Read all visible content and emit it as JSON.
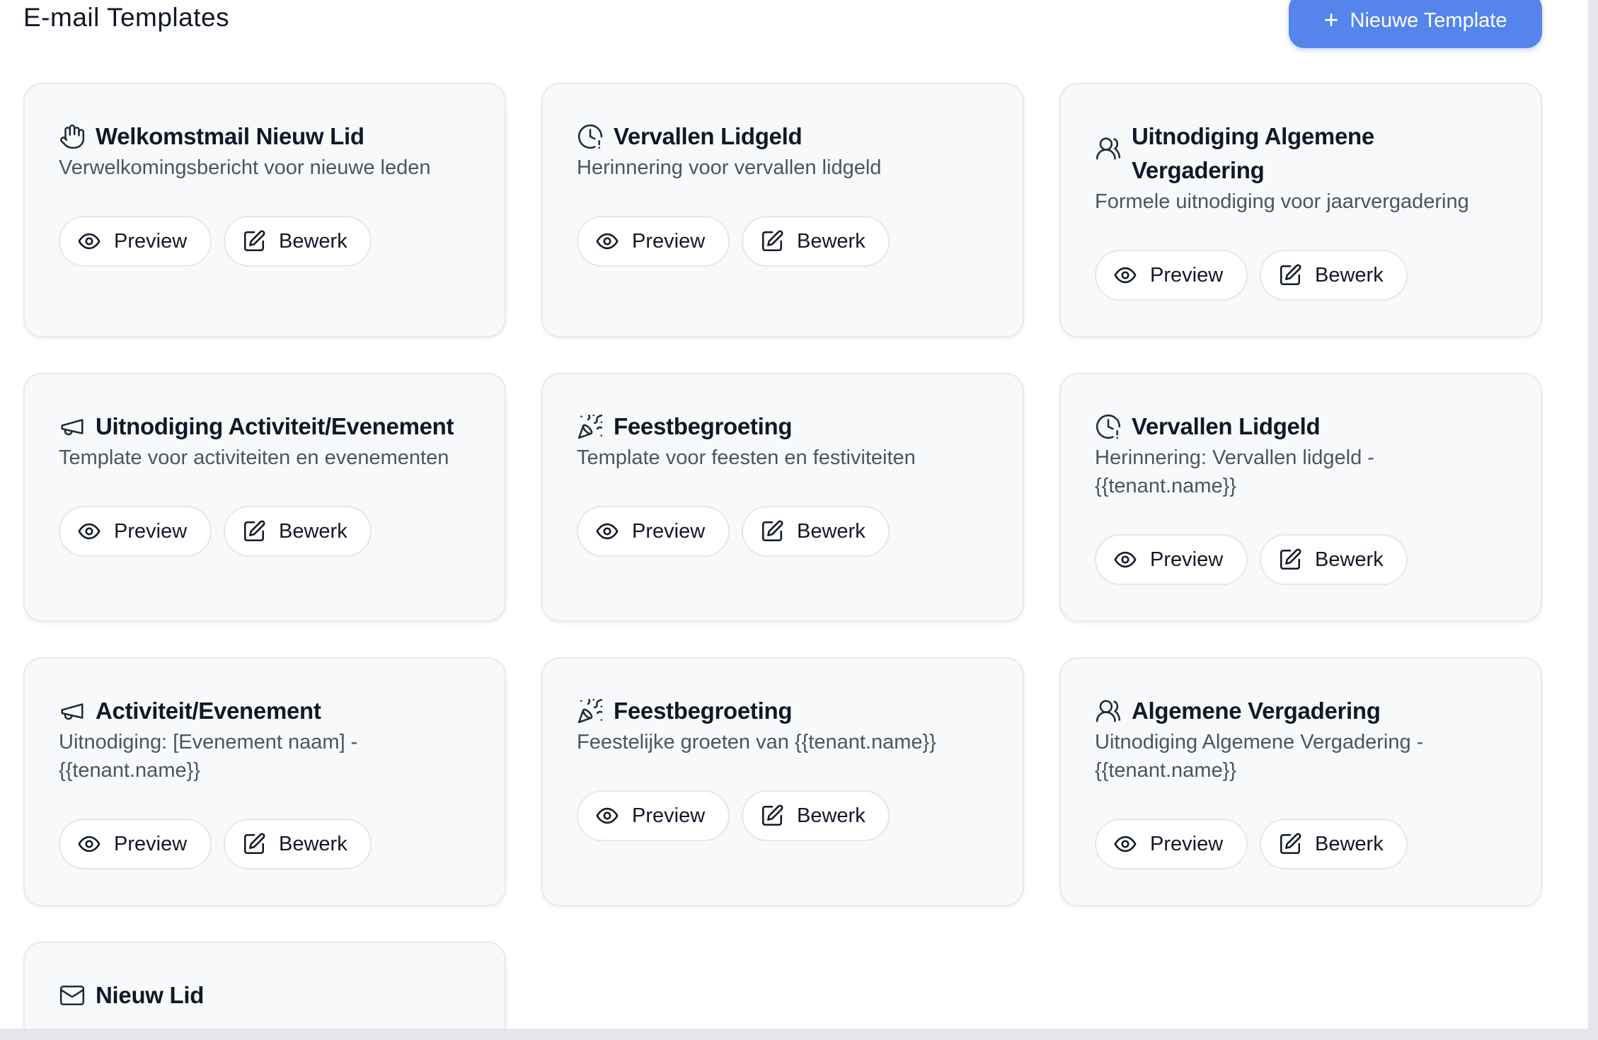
{
  "page": {
    "title": "E-mail Templates"
  },
  "header": {
    "new_button_label": "Nieuwe Template",
    "new_button_icon": "plus-icon",
    "accent": "#5585ec"
  },
  "actions": {
    "preview_label": "Preview",
    "edit_label": "Bewerk"
  },
  "templates": [
    {
      "icon": "waving-hand-icon",
      "title": "Welkomstmail Nieuw Lid",
      "description": "Verwelkomingsbericht voor nieuwe leden"
    },
    {
      "icon": "clock-alert-icon",
      "title": "Vervallen Lidgeld",
      "description": "Herinnering voor vervallen lidgeld"
    },
    {
      "icon": "users-icon",
      "title": "Uitnodiging Algemene Vergadering",
      "description": "Formele uitnodiging voor jaarvergadering"
    },
    {
      "icon": "megaphone-icon",
      "title": "Uitnodiging Activiteit/Evenement",
      "description": "Template voor activiteiten en evenementen"
    },
    {
      "icon": "party-popper-icon",
      "title": "Feestbegroeting",
      "description": "Template voor feesten en festiviteiten"
    },
    {
      "icon": "clock-alert-icon",
      "title": "Vervallen Lidgeld",
      "description": "Herinnering: Vervallen lidgeld - {{tenant.name}}"
    },
    {
      "icon": "megaphone-icon",
      "title": "Activiteit/Evenement",
      "description": "Uitnodiging: [Evenement naam] - {{tenant.name}}"
    },
    {
      "icon": "party-popper-icon",
      "title": "Feestbegroeting",
      "description": "Feestelijke groeten van {{tenant.name}}"
    },
    {
      "icon": "users-icon",
      "title": "Algemene Vergadering",
      "description": "Uitnodiging Algemene Vergadering - {{tenant.name}}"
    },
    {
      "icon": "mail-icon",
      "title": "Nieuw Lid",
      "description": ""
    }
  ]
}
